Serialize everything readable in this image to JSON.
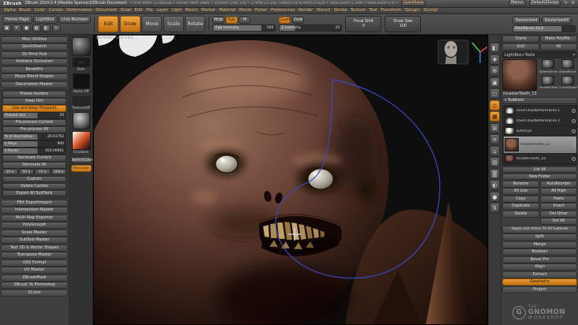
{
  "colors": {
    "accent": "#e0912f",
    "viewport_bg": "#0e0e0e",
    "curve_blue": "#3c49c0",
    "skin_brown": "#6e463a"
  },
  "titlebar": {
    "logo": "ZBrush",
    "title": "ZBrush 2024.0.4 [Maddie Spencer]/ZBrush Document",
    "stats": "• Free Mem 13.895GB • Active Mem 2486 • Scratch Disk 156 • ZTime 23.916 Time|0:24.47min|23.92b • PolyCount•1.34M • NeoCount•3-6 •",
    "quicksave": "QuickSave",
    "menus_button": "Menus",
    "zscript_button": "DefaultZScript"
  },
  "menubar": {
    "items": [
      "Alpha",
      "Brush",
      "Color",
      "Curves",
      "Deformation",
      "Document",
      "Draw",
      "Edit",
      "File",
      "Layer",
      "Light",
      "Macro",
      "Marker",
      "Material",
      "Movie",
      "Picker",
      "Preferences",
      "Render",
      "Stencil",
      "Stroke",
      "Texture",
      "Tool",
      "Transform",
      "Zplugin",
      "Zscript"
    ]
  },
  "shelf": {
    "home_page": "Home Page",
    "lightbox": "LightBox",
    "live_boolean": "Live Boolean",
    "quick_icons": [
      {
        "name": "projection-master-icon",
        "glyph": "▣"
      },
      {
        "name": "light-icon",
        "glyph": "☀"
      },
      {
        "name": "material-sphere-icon",
        "glyph": "●"
      },
      {
        "name": "texture-map-icon",
        "glyph": "▦"
      },
      {
        "name": "alpha-map-icon",
        "glyph": "◧"
      },
      {
        "name": "stroke-curve-icon",
        "glyph": "≈"
      }
    ],
    "modes": [
      {
        "label": "Edit",
        "active": true
      },
      {
        "label": "Draw",
        "active": true
      },
      {
        "label": "Move"
      },
      {
        "label": "Scale"
      },
      {
        "label": "Rotate"
      }
    ],
    "paint_modes": [
      {
        "label": "Mrgb"
      },
      {
        "label": "Rgb",
        "active": true
      },
      {
        "label": "M"
      }
    ],
    "rgb_intensity": {
      "label": "Rgb Intensity",
      "value": "100"
    },
    "sculpt_modes": [
      {
        "label": "Zadd",
        "active": true
      },
      {
        "label": "Zsub"
      }
    ],
    "z_intensity": {
      "label": "Z Intensity",
      "value": "25"
    },
    "focal_shift": {
      "label": "Focal Shift",
      "value": "0"
    },
    "draw_size": {
      "label": "Draw Size",
      "value": "100"
    },
    "right_buttons": [
      {
        "label": "Rasterized"
      },
      {
        "label": "RasterizeAll"
      }
    ],
    "total_points": "TotalPoints 43.6"
  },
  "canvas": {
    "status": "READING GOZ FILE..."
  },
  "zplugin": {
    "top_items": [
      "Misc Utilities",
      "QuickSketch",
      "3D Print Hub",
      "Ambient Occlusion",
      "BevelPro",
      "Maya Blend Shapes",
      "Decimation Master"
    ],
    "decimation": {
      "toggles": [
        {
          "label": "Freeze borders"
        },
        {
          "label": "Keep UVs"
        },
        {
          "label": "Use and Keep Polypaint",
          "active": true
        }
      ],
      "preload": {
        "label": "Preload size",
        "value": "20"
      },
      "preprocess": [
        "Pre-process Current",
        "Pre-process All"
      ],
      "sliders": [
        {
          "label": "% of decimation",
          "value": "20.61702"
        },
        {
          "label": "k Polys",
          "value": "900"
        },
        {
          "label": "k Points",
          "value": "450.00061"
        }
      ],
      "decimate": [
        "Decimate Current",
        "Decimate All"
      ],
      "presets": [
        "20 k",
        "50 k",
        "75 k",
        "100 k"
      ],
      "custom": "Custom",
      "extras": [
        "Delete Caches",
        "Export All SubTools"
      ]
    },
    "bottom_items": [
      "FBX ExportImport",
      "Intersection Masker",
      "Multi Map Exporter",
      "PolyGroupIt",
      "Scale Master",
      "SubTool Master",
      "Text 3D & Vector Shapes",
      "Transpose Master",
      "USD Format",
      "UV Master",
      "ZBrushMark",
      "ZBrush To Photoshop",
      "ZColor"
    ]
  },
  "tray": {
    "stroke_label": "Dots",
    "alpha_label": "Alpha Off",
    "texture_label": "TextureOff",
    "gradient_label": "Gradient",
    "switch_color": "SwitchColor",
    "alternate": "Alternate"
  },
  "right_strip": {
    "items": [
      {
        "name": "bpr-render-icon",
        "glyph": "◧"
      },
      {
        "name": "scroll-canvas-icon",
        "glyph": "✚"
      },
      {
        "name": "zoom-canvas-icon",
        "glyph": "⊕"
      },
      {
        "name": "actual-size-icon",
        "glyph": "▣"
      },
      {
        "name": "aa-half-icon",
        "glyph": "◻"
      },
      {
        "name": "persp-icon",
        "glyph": "◇",
        "active": true
      },
      {
        "name": "floor-grid-icon",
        "glyph": "▦",
        "active": true
      },
      {
        "name": "local-transform-icon",
        "glyph": "⊞"
      },
      {
        "name": "local-symmetry-icon",
        "glyph": "≡"
      },
      {
        "name": "frame-mesh-icon",
        "glyph": "⌂"
      },
      {
        "name": "polyframe-icon",
        "glyph": "▤"
      },
      {
        "name": "transparency-icon",
        "glyph": "▒"
      },
      {
        "name": "ghost-icon",
        "glyph": "◐"
      },
      {
        "name": "solo-icon",
        "glyph": "●"
      },
      {
        "name": "xpose-icon",
        "glyph": "⇅"
      }
    ]
  },
  "tool": {
    "top_buttons": [
      "Clone",
      "Make PolyMe..",
      "GoZ",
      "All"
    ],
    "lightbox_bar": "LightBox>Tools",
    "current_name": "mcasterTeeth_13",
    "recent": [
      "SphereBrush",
      "AlphaBrush",
      "mcasterTeeth",
      "CurveStrapSnap"
    ],
    "subtool": {
      "header": "Subtool",
      "items": [
        {
          "name": "coverCloudBeforeFaces.1",
          "kind": "cloud"
        },
        {
          "name": "coverCloudBeforeFaces.2",
          "kind": "cloud"
        },
        {
          "name": "outerEye",
          "kind": "eye"
        },
        {
          "name": "mcasterTeeth_13",
          "kind": "bust",
          "selected": true
        },
        {
          "name": "mcasterTeeth_16",
          "kind": "bust"
        }
      ],
      "list_all": "List All",
      "new_folder": "New Folder",
      "button_rows": [
        [
          "Rename",
          "AutoReorder"
        ],
        [
          "All Low",
          "All High"
        ],
        [
          "Copy",
          "Paste"
        ],
        [
          "Duplicate",
          "Insert"
        ],
        [
          "Delete",
          "Del Other"
        ],
        [
          "",
          "Del All"
        ]
      ],
      "apply_last": "Apply Last Action To All Subtools"
    },
    "sections": [
      {
        "label": "Split"
      },
      {
        "label": "Merge"
      },
      {
        "label": "Boolean"
      },
      {
        "label": "Bevel Pro"
      },
      {
        "label": "Align"
      },
      {
        "label": "Extract"
      },
      {
        "label": "Geometry",
        "active": true
      },
      {
        "label": "Project"
      }
    ]
  },
  "watermark": {
    "the": "THE",
    "gnomon": "GNOMON",
    "workshop": "WORKSHOP"
  }
}
